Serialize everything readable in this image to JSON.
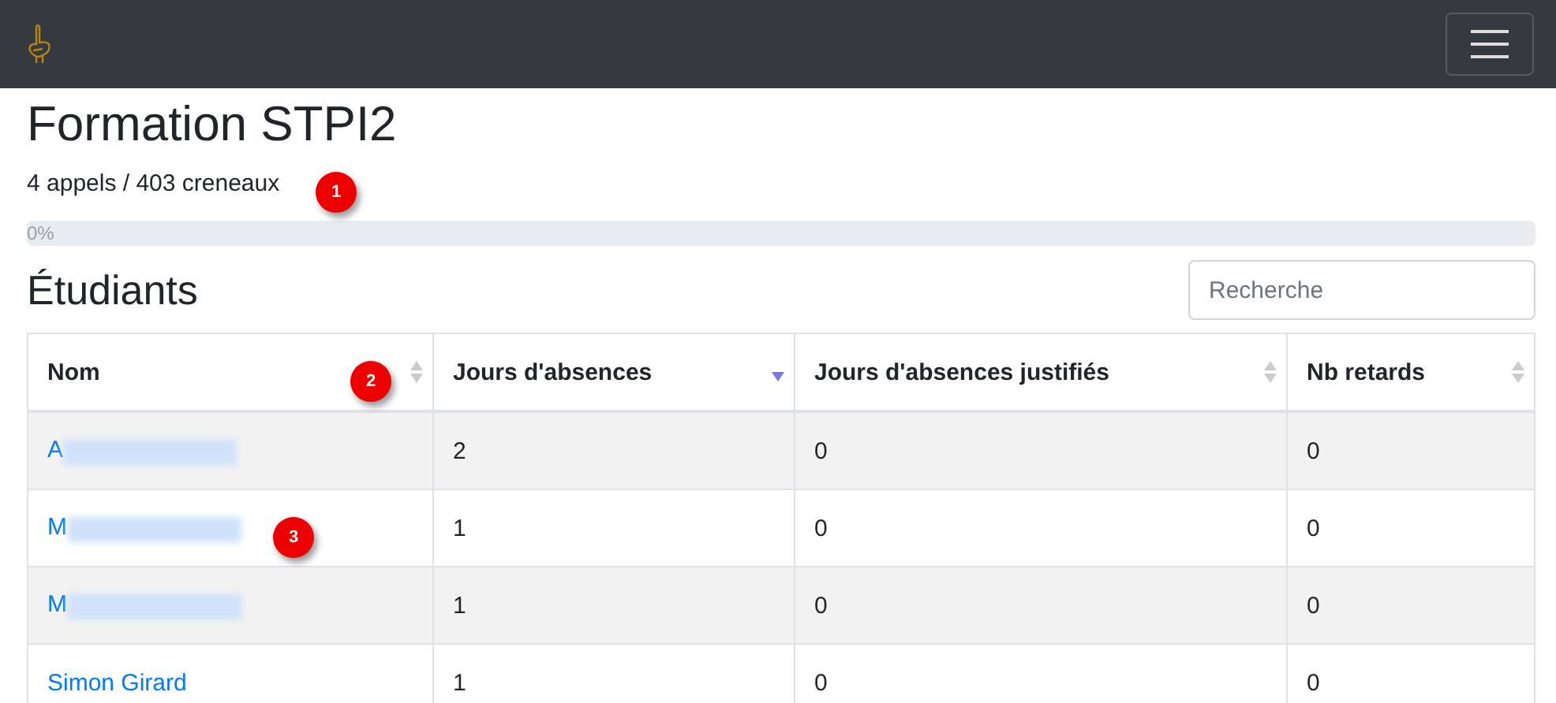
{
  "title": "Formation STPI2",
  "summary": "4 appels / 403 creneaux",
  "progress": {
    "level": 0,
    "reading": "0%"
  },
  "section_title": "Étudiants",
  "search": {
    "placeholder": "Recherche"
  },
  "table": {
    "columns": [
      {
        "label": "Nom",
        "sorted": false
      },
      {
        "label": "Jours d'absences",
        "sorted": true
      },
      {
        "label": "Jours d'absences justifiés",
        "sorted": false
      },
      {
        "label": "Nb retards",
        "sorted": false
      }
    ],
    "rows": [
      {
        "redacted": true,
        "cells": [
          "A",
          "2",
          "0",
          "0"
        ]
      },
      {
        "redacted": true,
        "cells": [
          "M",
          "1",
          "0",
          "0"
        ]
      },
      {
        "redacted": true,
        "cells": [
          "M",
          "1",
          "0",
          "0"
        ]
      },
      {
        "redacted": false,
        "cells": [
          "Simon Girard",
          "1",
          "0",
          "0"
        ]
      }
    ]
  },
  "markers": [
    "1",
    "2",
    "3"
  ]
}
